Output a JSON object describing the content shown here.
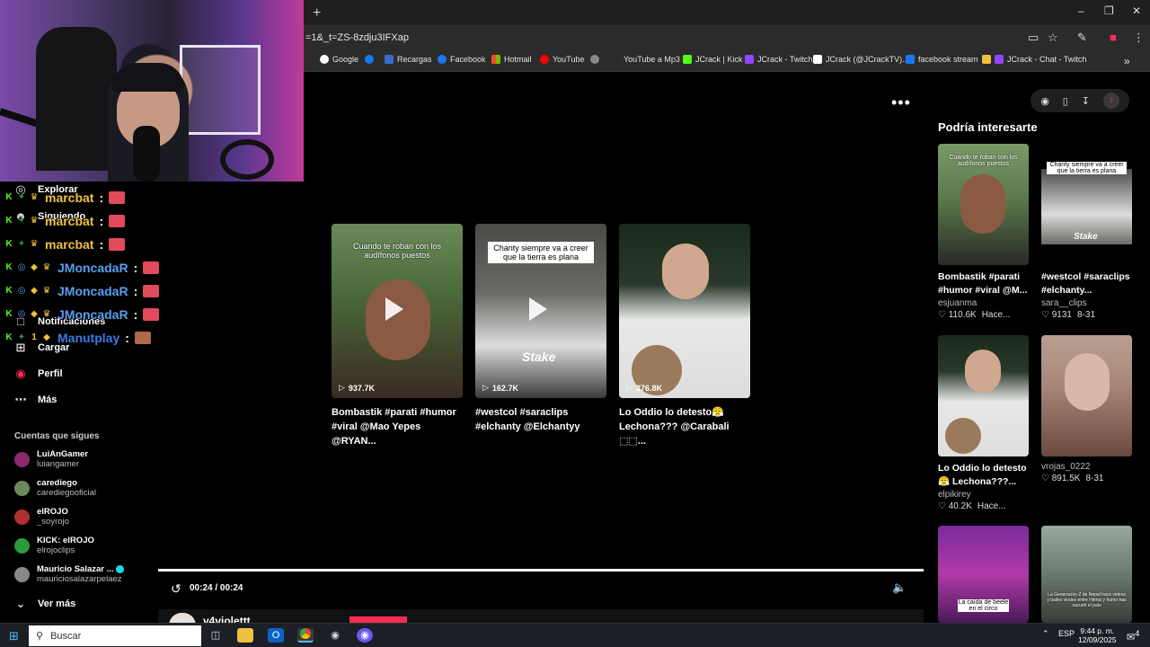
{
  "browser": {
    "url": "=1&_t=ZS-8zdju3IFXap",
    "new_tab": "+",
    "bookmarks": [
      "Google",
      "Facebook",
      "Recargas",
      "Facebook",
      "Hotmail",
      "YouTube",
      "YouTube a Mp3",
      "JCrack | Kick",
      "JCrack - Twitch",
      "JCrack (@JCrackTV)...",
      "facebook stream",
      "JCrack - Chat - Twitch"
    ]
  },
  "sidebar": {
    "items": [
      {
        "icon": "compass-icon",
        "label": "Explorar"
      },
      {
        "icon": "following-icon",
        "label": "Siguiendo"
      },
      {
        "icon": "inbox-icon",
        "label": "Notificaciones"
      },
      {
        "icon": "upload-icon",
        "label": "Cargar"
      },
      {
        "icon": "profile-icon",
        "label": "Perfil"
      },
      {
        "icon": "more-icon",
        "label": "Más"
      }
    ],
    "following_title": "Cuentas que sigues",
    "accounts": [
      {
        "name": "LuiAnGamer",
        "handle": "luiangamer",
        "color": "#8a2a6a"
      },
      {
        "name": "carediego",
        "handle": "carediegooficial",
        "color": "#6a8a5a"
      },
      {
        "name": "elROJO",
        "handle": "_soyrojo",
        "color": "#b03030"
      },
      {
        "name": "KICK: elROJO",
        "handle": "elrojoclips",
        "color": "#2a9a3a"
      },
      {
        "name": "Mauricio Salazar ...",
        "handle": "mauriciosalazarpelaez",
        "color": "#888888"
      }
    ],
    "see_more": "Ver más"
  },
  "chat": [
    {
      "user": "marcbat",
      "color": "#f0c040",
      "badges": [
        "K",
        "✦",
        "♛"
      ]
    },
    {
      "user": "marcbat",
      "color": "#f0c040",
      "badges": [
        "K",
        "✦",
        "♛"
      ]
    },
    {
      "user": "marcbat",
      "color": "#f0c040",
      "badges": [
        "K",
        "✦",
        "♛"
      ]
    },
    {
      "user": "JMoncadaR",
      "color": "#5a9ef0",
      "badges": [
        "K",
        "◎",
        "◆",
        "♛"
      ]
    },
    {
      "user": "JMoncadaR",
      "color": "#5a9ef0",
      "badges": [
        "K",
        "◎",
        "◆",
        "♛"
      ]
    },
    {
      "user": "JMoncadaR",
      "color": "#5a9ef0",
      "badges": [
        "K",
        "◎",
        "◆",
        "♛"
      ]
    },
    {
      "user": "Manutplay",
      "color": "#3a7ae0",
      "badges": [
        "K",
        "✦",
        "1",
        "◆"
      ]
    }
  ],
  "videos": [
    {
      "caption": "Cuando te roban con los audífonos puestos",
      "views": "937.7K",
      "title1": "Bombastik #parati #humor",
      "title2": "#viral @Mao Yepes @RYAN..."
    },
    {
      "caption": "Chanty siempre va a creer que la tierra es plana",
      "views": "162.7K",
      "title1": "#westcol #saraclips",
      "title2": "#elchanty @Elchantyy"
    },
    {
      "caption": "",
      "views": "376.8K",
      "title1": "Lo Oddio lo detesto😤",
      "title2": "Lechona??? @Carabali ⬚⬚..."
    }
  ],
  "player": {
    "time": "00:24 / 00:24",
    "progress": 1.0,
    "author": "v4violettt"
  },
  "recommendations": {
    "title": "Podría interesarte",
    "items": [
      {
        "title1": "Bombastik #parati",
        "title2": "#humor #viral @M...",
        "author": "esjuanma",
        "likes": "110.6K",
        "date": "Hace...",
        "caption": "Cuando te roban con los audífonos puestos"
      },
      {
        "title1": "#westcol #saraclips",
        "title2": "#elchanty...",
        "author": "sara__clips",
        "likes": "9131",
        "date": "8-31",
        "caption": "Chanty siempre va a creer que la tierra es plana"
      },
      {
        "title1": "Lo Oddio lo detesto",
        "title2": "😤 Lechona???...",
        "author": "elpikirey",
        "likes": "40.2K",
        "date": "Hace...",
        "caption": ""
      },
      {
        "title1": "",
        "title2": "",
        "author": "vrojas_0222",
        "likes": "891.5K",
        "date": "8-31",
        "caption": ""
      },
      {
        "caption": "La caída de beele en el circo"
      },
      {
        "caption": "La Generación Z de Nepal hace videos y bailes virales entre Hitmix y humo tras sacudir el país"
      }
    ]
  },
  "taskbar": {
    "search": "Buscar",
    "lang": "ESP",
    "time": "9:44 p. m.",
    "date": "12/09/2025",
    "notifications": "4"
  }
}
